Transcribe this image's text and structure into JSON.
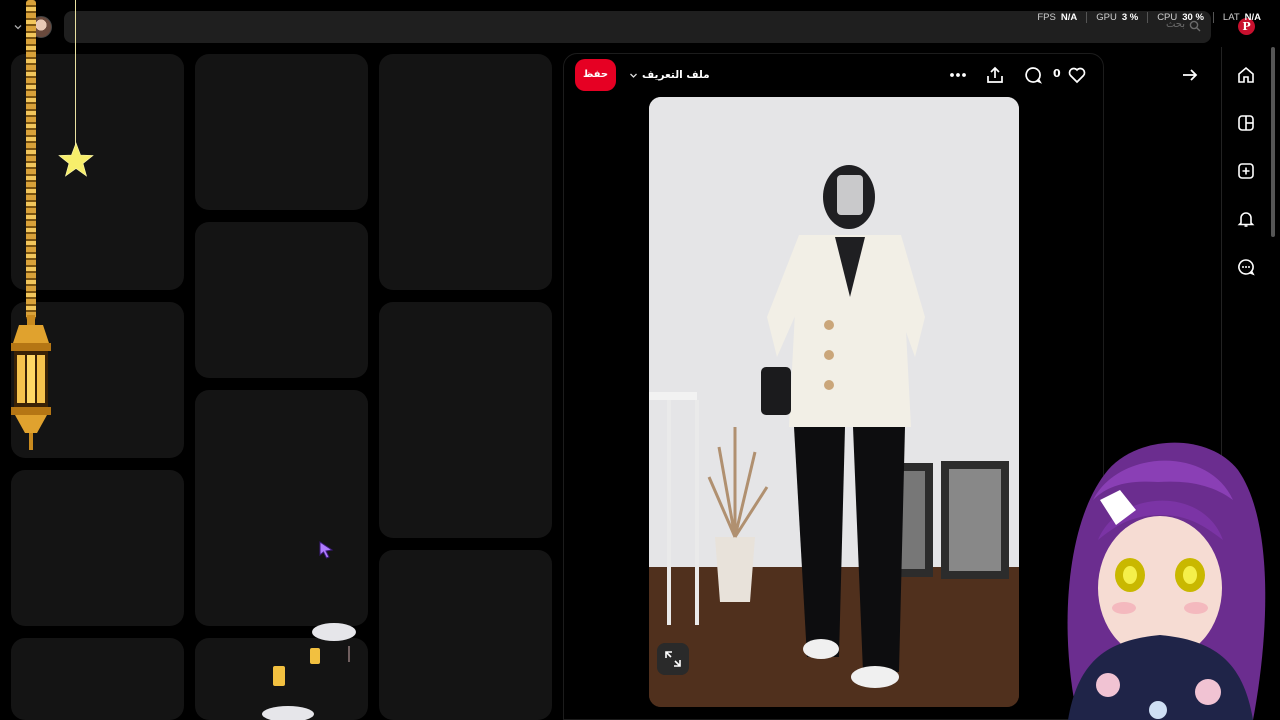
{
  "search": {
    "placeholder": "بحث"
  },
  "perf": [
    {
      "label": "FPS",
      "value": "N/A"
    },
    {
      "label": "GPU",
      "value": "3 %"
    },
    {
      "label": "CPU",
      "value": "30 %"
    },
    {
      "label": "LAT",
      "value": "N/A"
    }
  ],
  "pin": {
    "save_label": "حفظ",
    "profile_label": "ملف التعريف",
    "comment_count": "0"
  },
  "icons": {
    "brand": "pinterest-logo",
    "nav": [
      "home-icon",
      "boards-icon",
      "create-icon",
      "notifications-icon",
      "messages-icon"
    ]
  },
  "colors": {
    "accent": "#e60023",
    "background": "#000000",
    "tile": "#141414",
    "searchbar": "#1f1f1f"
  }
}
